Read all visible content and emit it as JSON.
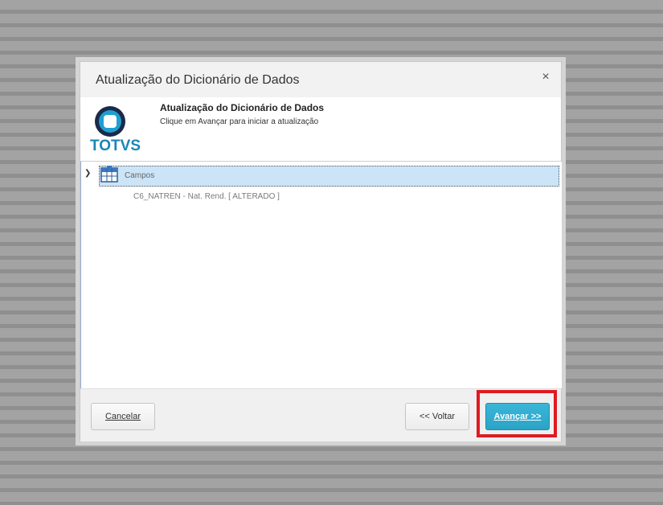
{
  "dialog": {
    "title": "Atualização do Dicionário de Dados",
    "close_label": "×"
  },
  "header": {
    "logo_text": "TOTVS",
    "title": "Atualização do Dicionário de Dados",
    "subtitle": "Clique em Avançar para iniciar a atualização"
  },
  "tree": {
    "root_label": "Campos",
    "root_icon": "table-grid-icon",
    "children": [
      "C6_NATREN - Nat. Rend.  [ ALTERADO ]"
    ]
  },
  "footer": {
    "cancel_label": "Cancelar",
    "back_label": "<< Voltar",
    "next_label": "Avançar >>"
  },
  "colors": {
    "accent": "#2aa3c7",
    "selection": "#cce4f7",
    "highlight": "#e01a22",
    "brand": "#1a86b8"
  }
}
